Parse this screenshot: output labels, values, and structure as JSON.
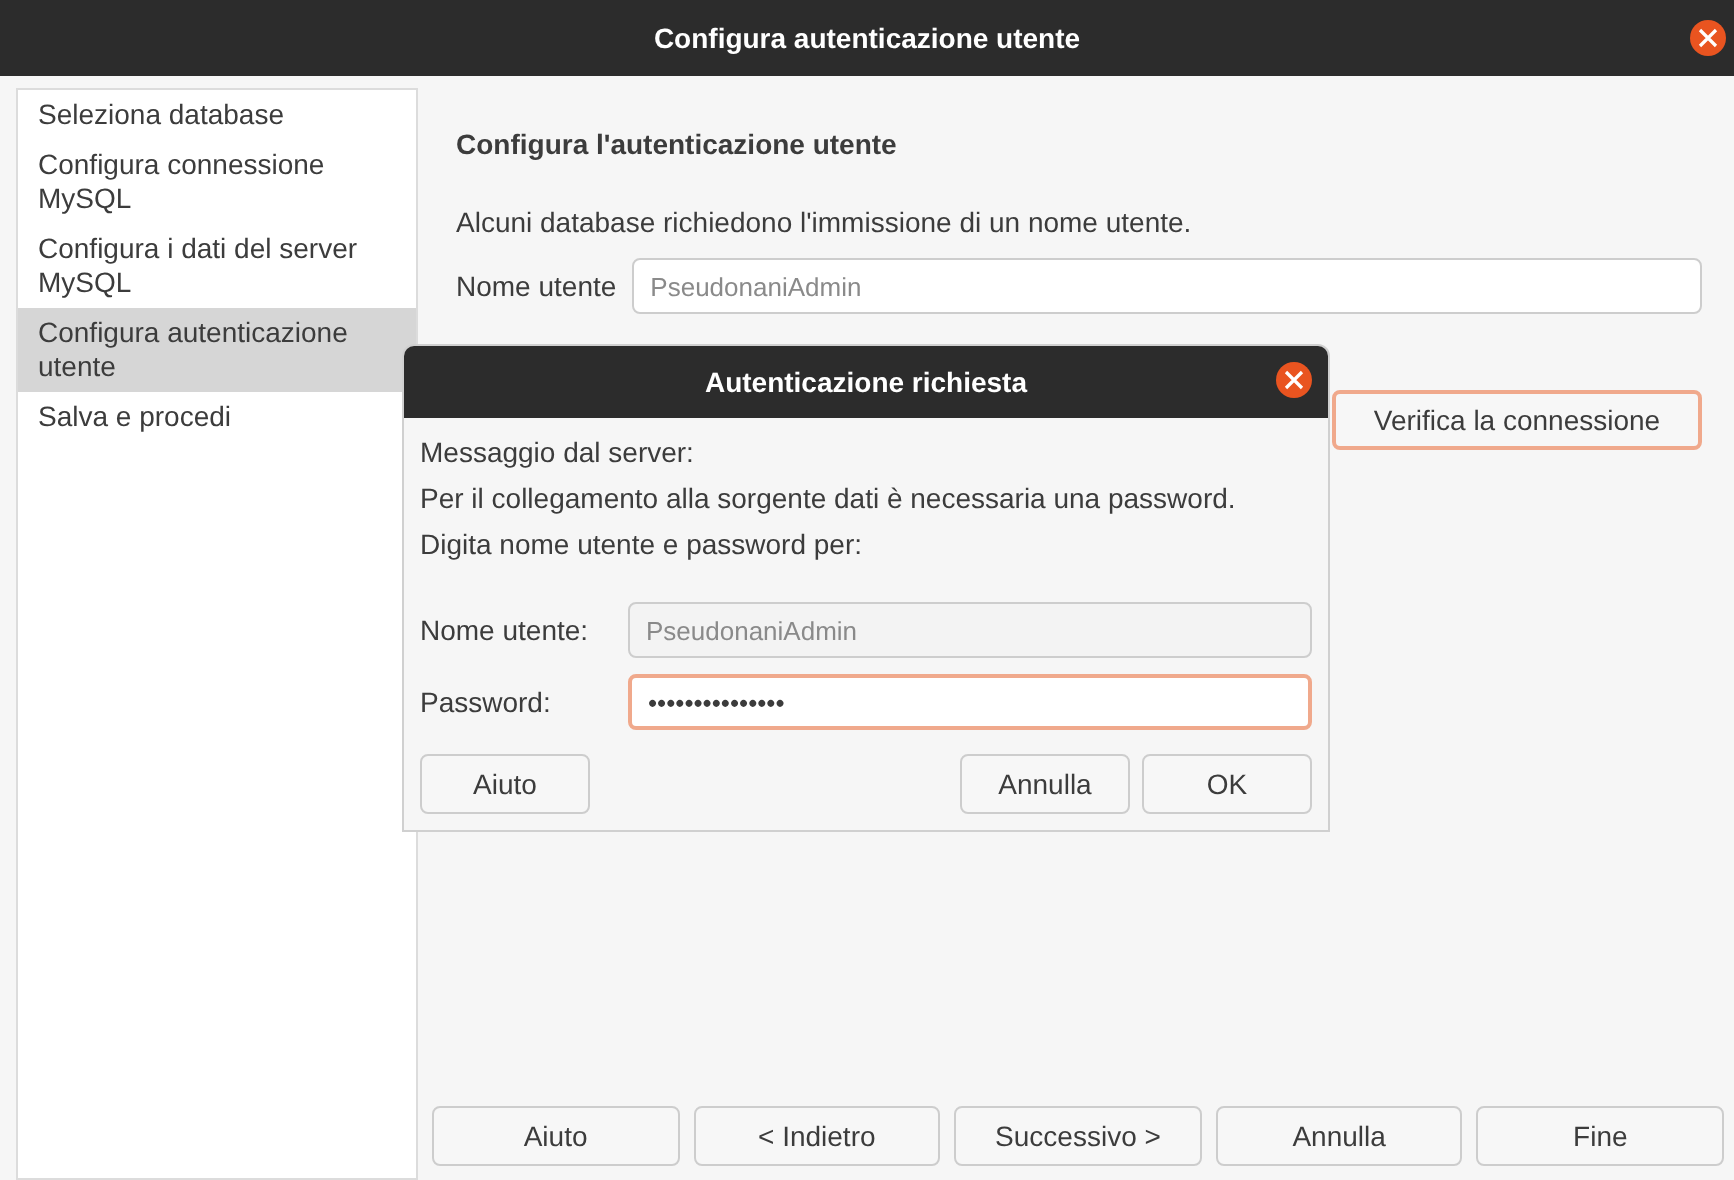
{
  "window": {
    "title": "Configura autenticazione utente"
  },
  "sidebar": {
    "items": [
      {
        "label": "Seleziona database",
        "selected": false
      },
      {
        "label": "Configura connessione MySQL",
        "selected": false
      },
      {
        "label": "Configura i dati del server MySQL",
        "selected": false
      },
      {
        "label": "Configura autenticazione utente",
        "selected": true
      },
      {
        "label": "Salva e procedi",
        "selected": false
      }
    ]
  },
  "main": {
    "heading": "Configura l'autenticazione utente",
    "description": "Alcuni database richiedono l'immissione di un nome utente.",
    "username_label": "Nome utente",
    "username_value": "PseudonaniAdmin",
    "test_button": {
      "label": "Verifica la connessione",
      "focused": true
    }
  },
  "dialog": {
    "title": "Autenticazione richiesta",
    "messages": [
      "Messaggio dal server:",
      "Per il collegamento alla sorgente dati  è necessaria una password.",
      "Digita nome utente e password per:"
    ],
    "fields": [
      {
        "label": "Nome utente:",
        "value": "PseudonaniAdmin",
        "disabled": true,
        "focused": false
      },
      {
        "label": "Password:",
        "value": "•••••••••••••••",
        "disabled": false,
        "focused": true
      }
    ],
    "help_button": "Aiuto",
    "buttons": [
      "Annulla",
      "OK"
    ]
  },
  "footer_buttons": [
    "Aiuto",
    "< Indietro",
    "Successivo >",
    "Annulla",
    "Fine"
  ]
}
